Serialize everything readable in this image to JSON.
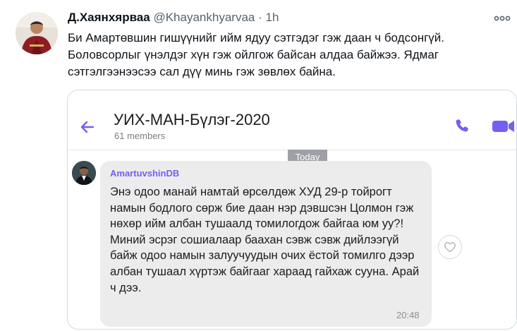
{
  "tweet": {
    "author_name": "Д.Хаянхярваа",
    "author_handle": "@Khayankhyarvaa",
    "separator": "·",
    "time": "1h",
    "more_icon": "more-dots-icon",
    "text": "Би Амартөвшин гишүүнийг ийм ядуу сэтгэдэг гэж даан ч бодсонгүй. Боловсорлыг үнэлдэг хүн гэж ойлгож байсан алдаа байжээ. Ядмаг сэтгэлгээнээсээ сал дүү минь гэж зөвлөх байна."
  },
  "chat": {
    "title": "УИХ-МАН-Бүлэг-2020",
    "members": "61 members",
    "back_icon": "back-arrow-icon",
    "phone_icon": "phone-icon",
    "video_icon": "video-camera-icon",
    "accent_color": "#7360f2",
    "date_badge": "Today",
    "message": {
      "sender": "AmartuvshinDB",
      "text": "Энэ одоо манай намтай өрсөлдөж ХУД 29-р тойрогт намын бодлого сөрж бие даан нэр дэвшсэн Цолмон гэж нөхөр ийм албан тушаалд томилогдож байгаа юм уу?! Миний эсрэг сошиалаар баахан сэвж сэвж дийлээгүй байж одоо намын залуучуудын очих ёстой томилго дээр албан тушаал хүртэж байгааг хараад гайхаж сууна. Арай ч дээ.",
      "time": "20:48",
      "like_icon": "heart-outline-icon"
    }
  }
}
